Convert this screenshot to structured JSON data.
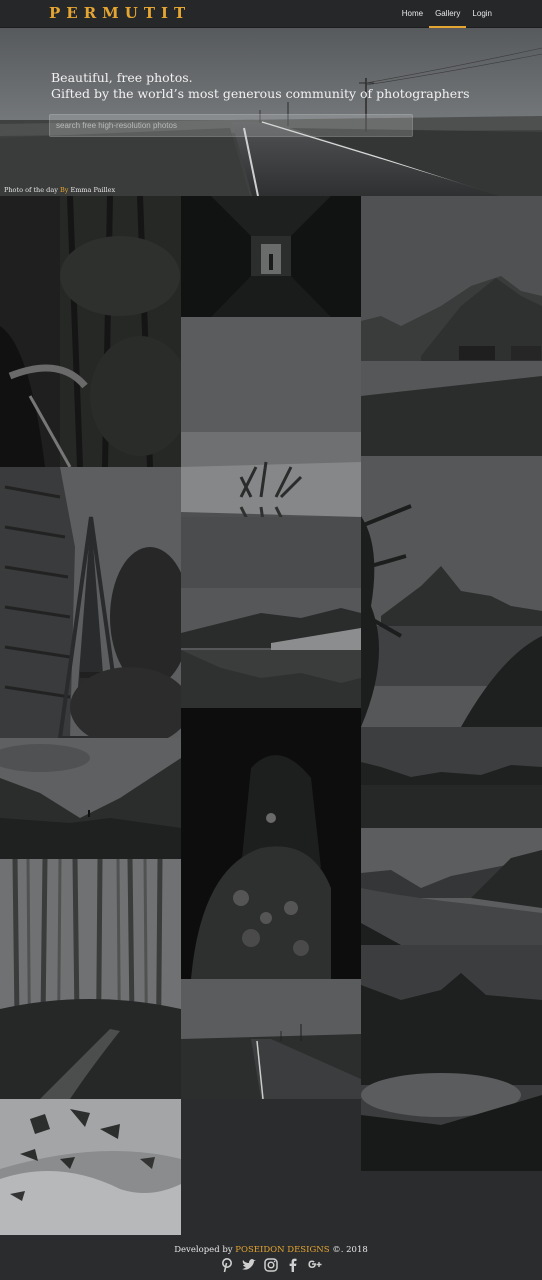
{
  "navbar": {
    "brand": "PERMUTIT",
    "links": [
      "Home",
      "Gallery",
      "Login"
    ],
    "active": "Gallery"
  },
  "hero": {
    "line1": "Beautiful, free photos.",
    "line2": "Gifted by the world’s most generous community of photographers",
    "search_placeholder": "search free high-resolution photos",
    "credit_prefix": "Photo of the day ",
    "credit_by": "By",
    "credit_name": " Emma Paillex"
  },
  "gallery": [
    {
      "name": "photo-forest-car-window"
    },
    {
      "name": "photo-dark-corridor"
    },
    {
      "name": "photo-mountain-coast-village"
    },
    {
      "name": "photo-lake-plant-reflection"
    },
    {
      "name": "photo-eiffel-tower"
    },
    {
      "name": "photo-mountain-lake-trees"
    },
    {
      "name": "photo-lake-mountains-reflection"
    },
    {
      "name": "photo-painted-woman-portrait"
    },
    {
      "name": "photo-valley-hiker"
    },
    {
      "name": "photo-dark-lake-horizon"
    },
    {
      "name": "photo-foggy-forest-path"
    },
    {
      "name": "photo-fjord-mountains"
    },
    {
      "name": "photo-mountain-peak-lake"
    },
    {
      "name": "photo-road-dusk"
    },
    {
      "name": "photo-snow-rocks"
    }
  ],
  "footer": {
    "prefix": "Developed by ",
    "brand": "POSEIDON DESIGNS",
    "suffix": " ©. 2018",
    "social_icons": [
      "pinterest-icon",
      "twitter-icon",
      "instagram-icon",
      "facebook-icon",
      "google-plus-icon"
    ]
  },
  "colors": {
    "accent": "#e5a532",
    "background": "#2b2c2e",
    "navbar": "#262729"
  }
}
